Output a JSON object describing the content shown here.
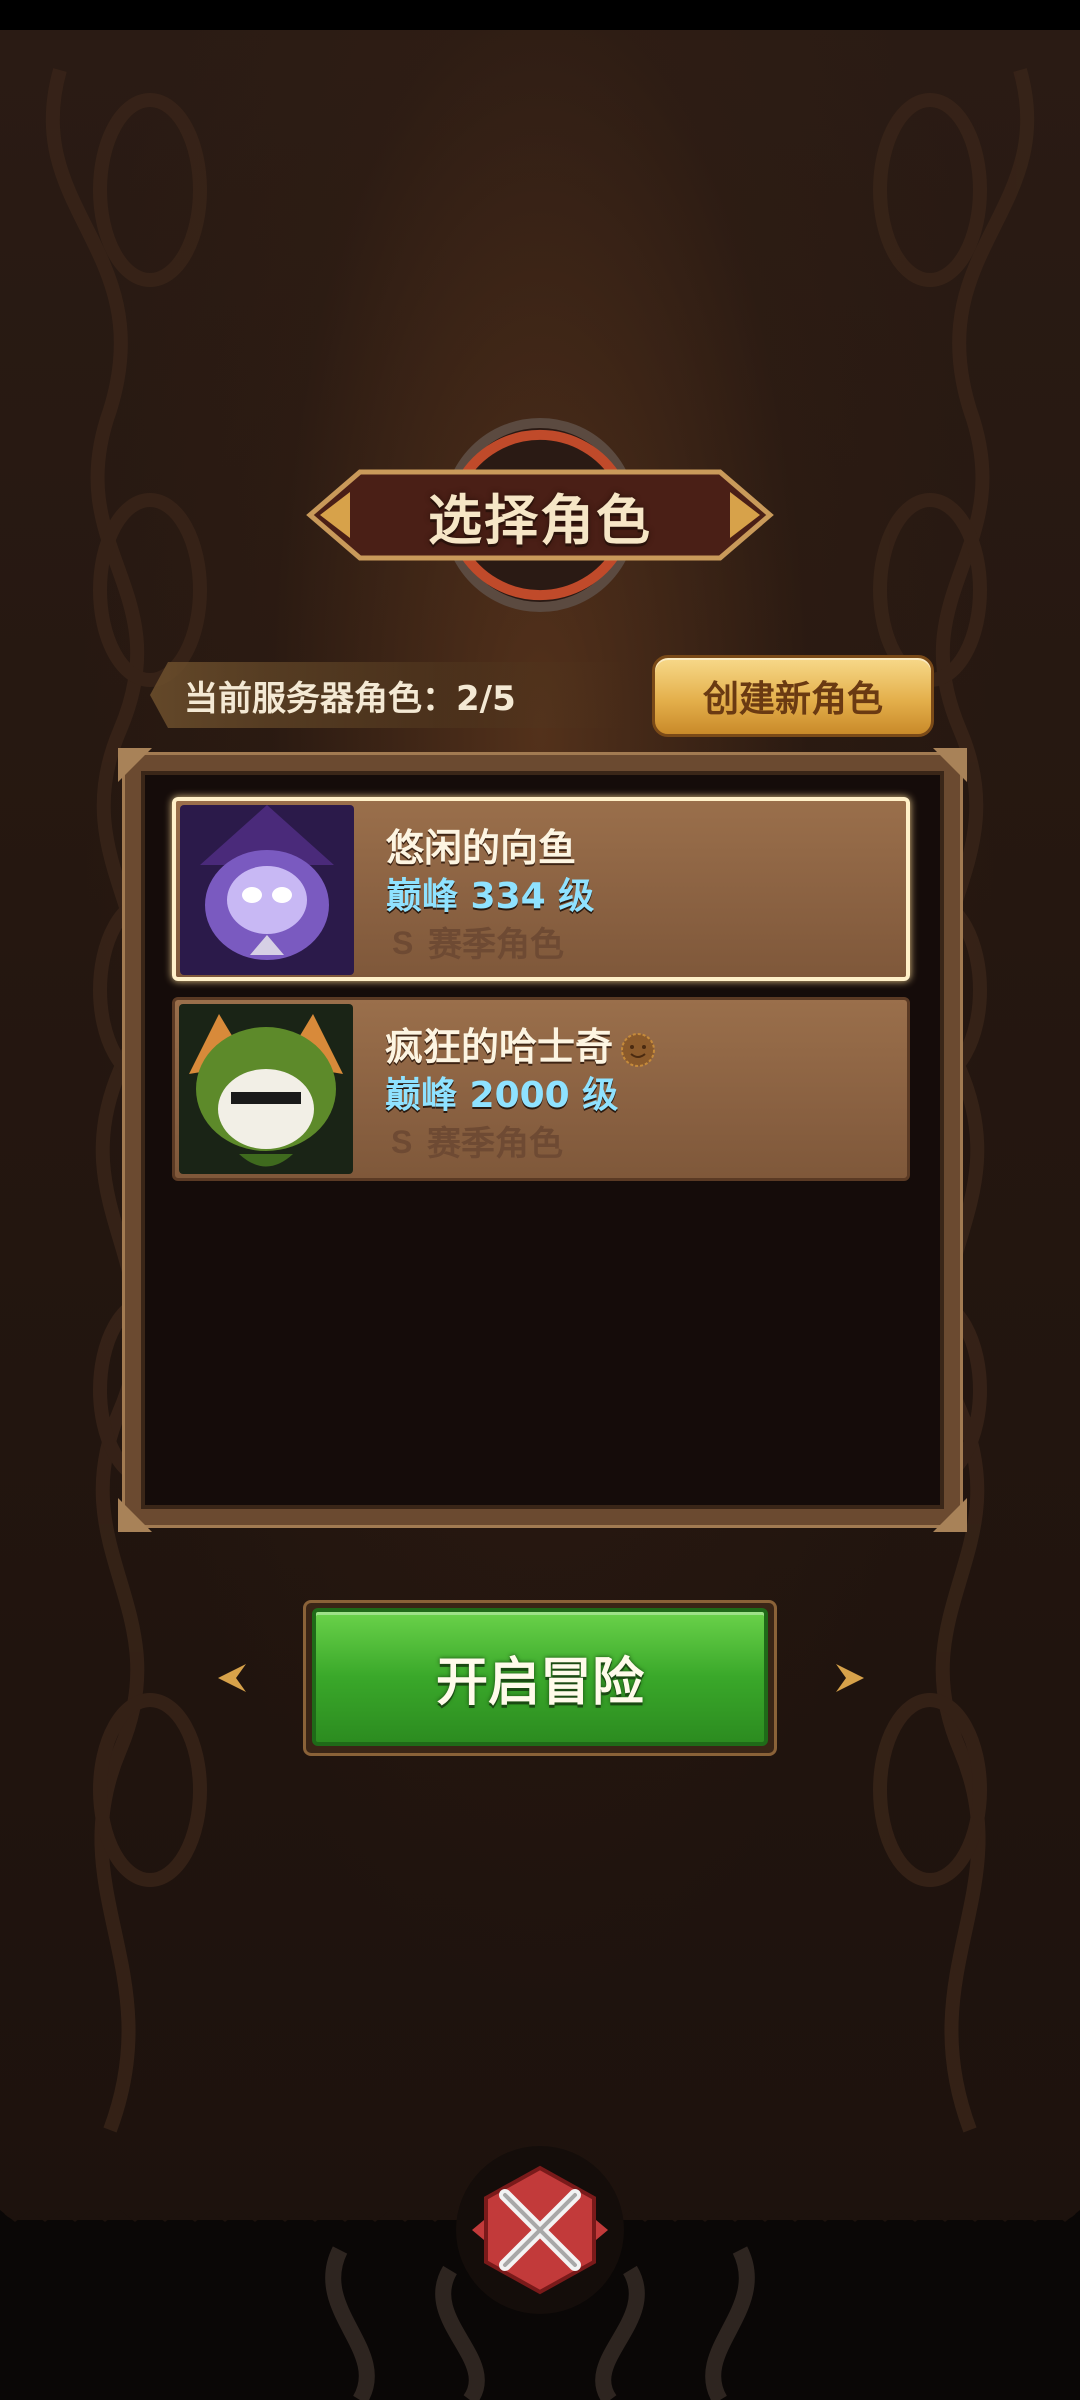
{
  "title": "选择角色",
  "server_count": "当前服务器角色：2/5",
  "create_button": "创建新角色",
  "characters": [
    {
      "name": "悠闲的向鱼",
      "level": "巅峰 334 级",
      "tag": "赛季角色",
      "selected": true,
      "avatar_icon": "purple-mage-avatar-icon"
    },
    {
      "name": "疯狂的哈士奇",
      "level": "巅峰 2000 级",
      "tag": "赛季角色",
      "selected": false,
      "avatar_icon": "green-hooded-fox-avatar-icon"
    }
  ],
  "start_button": "开启冒险",
  "colors": {
    "level_text": "#8fe2ff",
    "start_green": "#3aa82a",
    "create_gold": "#e4b04c",
    "card_brown": "#8b6242"
  }
}
